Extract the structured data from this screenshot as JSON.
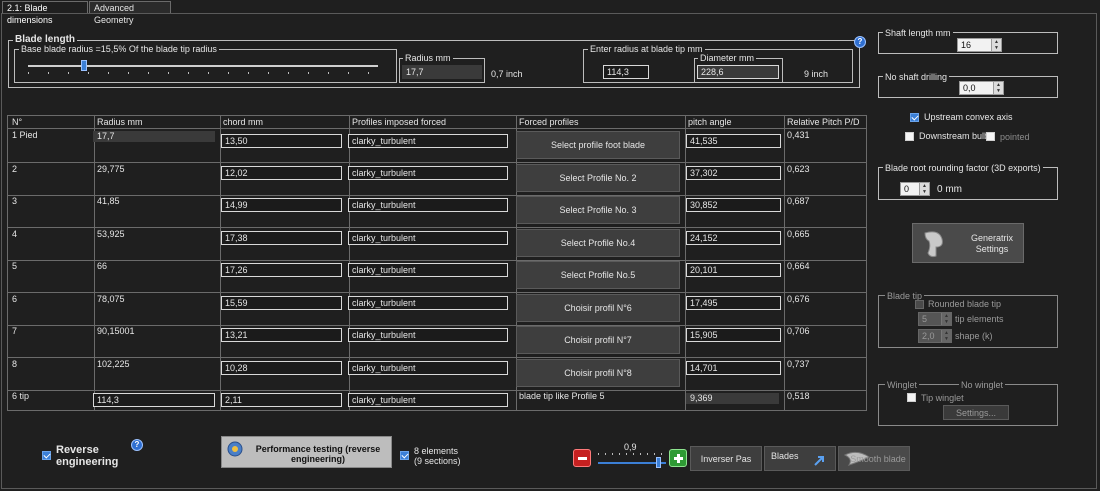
{
  "tabs": [
    "2.1: Blade dimensions",
    "Advanced Geometry"
  ],
  "blade_length": {
    "title": "Blade length",
    "base_radius_label": "Base blade radius =15,5% Of the blade tip radius",
    "radius_label": "Radius mm",
    "radius_value": "17,7",
    "radius_inch": "0,7 inch",
    "tip_group_label": "Enter radius at blade tip mm",
    "tip_radius_value": "114,3",
    "diameter_label": "Diameter  mm",
    "diameter_value": "228,6",
    "diameter_inch": "9 inch",
    "slider_position": 0.16
  },
  "shaft": {
    "length_label": "Shaft length mm",
    "length_value": "16",
    "drilling_label": "No shaft drilling",
    "drilling_value": "0,0"
  },
  "options": {
    "upstream_convex": "Upstream convex axis",
    "downstream_bulb": "Downstream bulb",
    "pointed": "pointed"
  },
  "root_rounding": {
    "label": "Blade root rounding factor (3D exports)",
    "value": "0",
    "unit": "0 mm"
  },
  "generatrix": {
    "line1": "Generatrix",
    "line2": "Settings"
  },
  "blade_tip": {
    "title": "Blade tip",
    "rounded": "Rounded blade tip",
    "elements_value": "5",
    "elements_label": "tip elements",
    "shape_value": "2,0",
    "shape_label": "shape (k)"
  },
  "winglet": {
    "title": "Winglet",
    "status": "No winglet",
    "tip_winglet": "Tip winglet",
    "settings": "Settings..."
  },
  "table": {
    "headers": [
      "N°",
      "Radius mm",
      "chord mm",
      "Profiles imposed forced",
      "Forced profiles",
      "pitch angle",
      "Relative Pitch P/D"
    ],
    "rows": [
      {
        "n": "1 Pied",
        "radius": "17,7",
        "chord": "13,50",
        "profile": "clarky_turbulent",
        "forced": "Select profile foot blade",
        "pitch": "41,535",
        "rel": "0,431"
      },
      {
        "n": "2",
        "radius": "29,775",
        "chord": "12,02",
        "profile": "clarky_turbulent",
        "forced": "Select Profile No. 2",
        "pitch": "37,302",
        "rel": "0,623"
      },
      {
        "n": "3",
        "radius": "41,85",
        "chord": "14,99",
        "profile": "clarky_turbulent",
        "forced": "Select Profile No. 3",
        "pitch": "30,852",
        "rel": "0,687"
      },
      {
        "n": "4",
        "radius": "53,925",
        "chord": "17,38",
        "profile": "clarky_turbulent",
        "forced": "Select Profile No.4",
        "pitch": "24,152",
        "rel": "0,665"
      },
      {
        "n": "5",
        "radius": "66",
        "chord": "17,26",
        "profile": "clarky_turbulent",
        "forced": "Select Profile No.5",
        "pitch": "20,101",
        "rel": "0,664"
      },
      {
        "n": "6",
        "radius": "78,075",
        "chord": "15,59",
        "profile": "clarky_turbulent",
        "forced": "Choisir profil N°6",
        "pitch": "17,495",
        "rel": "0,676"
      },
      {
        "n": "7",
        "radius": "90,15001",
        "chord": "13,21",
        "profile": "clarky_turbulent",
        "forced": "Choisir profil N°7",
        "pitch": "15,905",
        "rel": "0,706"
      },
      {
        "n": "8",
        "radius": "102,225",
        "chord": "10,28",
        "profile": "clarky_turbulent",
        "forced": "Choisir profil N°8",
        "pitch": "14,701",
        "rel": "0,737"
      },
      {
        "n": "6 tip",
        "radius": "114,3",
        "chord": "2,11",
        "profile": "clarky_turbulent",
        "forced": "blade tip like Profile 5",
        "pitch": "9,369",
        "rel": "0,518"
      }
    ]
  },
  "bottom": {
    "reverse_line1": "Reverse",
    "reverse_line2": "engineering",
    "perf_line1": "Performance testing (reverse",
    "perf_line2": "engineering)",
    "elements_line1": "8 elements",
    "elements_line2": "(9 sections)",
    "zoom_value": "0,9",
    "zoom_position": 0.9,
    "inverser": "Inverser Pas",
    "blades": "Blades",
    "smooth": "Smooth blade"
  },
  "colors": {
    "accent": "#3b7fd6",
    "background": "#1f1f1f",
    "border": "#bdbdbd"
  }
}
